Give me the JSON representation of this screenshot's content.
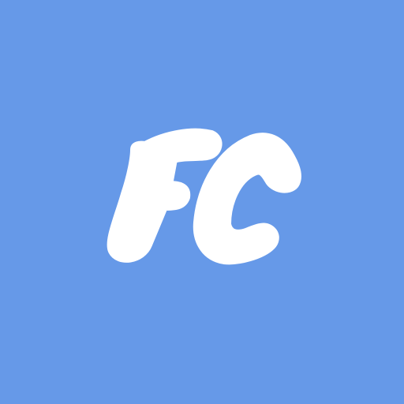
{
  "app_icon": {
    "monogram": "FC",
    "background_color": "#6699e8",
    "foreground_color": "#ffffff"
  }
}
